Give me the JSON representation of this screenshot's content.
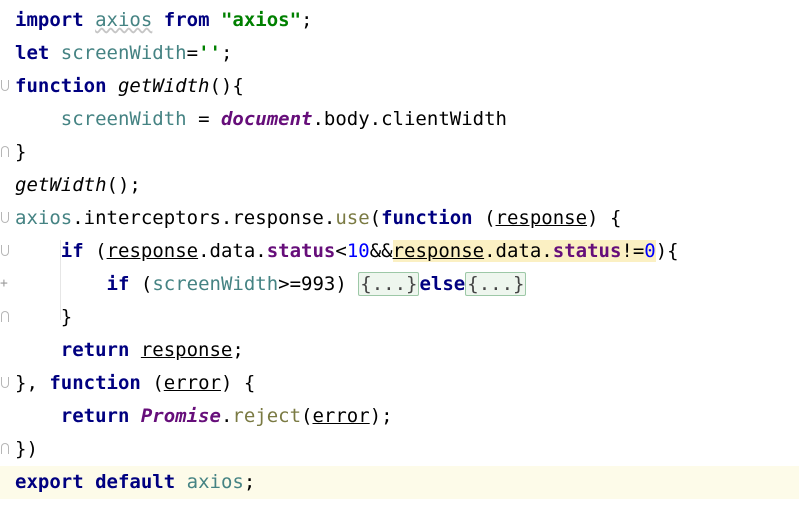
{
  "lines": [
    {
      "parts": [
        "import",
        "axios",
        "from",
        "\"axios\"",
        ";"
      ]
    },
    {
      "parts": [
        "let",
        "screenWidth",
        "=",
        "''",
        ";"
      ]
    },
    {
      "parts": [
        "function",
        "getWidth",
        "(){"
      ]
    },
    {
      "parts": [
        "screenWidth",
        "=",
        "document",
        ".body.clientWidth"
      ]
    },
    {
      "parts": [
        "}"
      ]
    },
    {
      "parts": [
        "getWidth",
        "();"
      ]
    },
    {
      "parts": [
        "axios",
        ".interceptors.response.",
        "use",
        "(",
        "function",
        "(",
        "response",
        ")",
        "{"
      ]
    },
    {
      "parts": [
        "if",
        "(",
        "response",
        ".data.",
        "status",
        "<",
        "10",
        "&&",
        "response",
        ".data.",
        "status",
        "!=",
        "0",
        "){"
      ]
    },
    {
      "parts": [
        "if",
        "(",
        "screenWidth",
        ">=",
        "993",
        ")",
        "{...}",
        "else",
        "{...}"
      ]
    },
    {
      "parts": [
        "}"
      ]
    },
    {
      "parts": [
        "return",
        "response",
        ";"
      ]
    },
    {
      "parts": [
        "},",
        "function",
        "(",
        "error",
        ")",
        "{"
      ]
    },
    {
      "parts": [
        "return",
        "Promise",
        ".",
        "reject",
        "(",
        "error",
        ");"
      ]
    },
    {
      "parts": [
        "})"
      ]
    },
    {
      "parts": [
        "export",
        "default",
        "axios",
        ";"
      ]
    }
  ],
  "colors": {
    "keyword": "#000080",
    "variable": "#458383",
    "string": "#008000",
    "global": "#660e7a",
    "number": "#0000ff",
    "current_line": "#fdfbe9",
    "folded_bg": "#eef6ee"
  }
}
